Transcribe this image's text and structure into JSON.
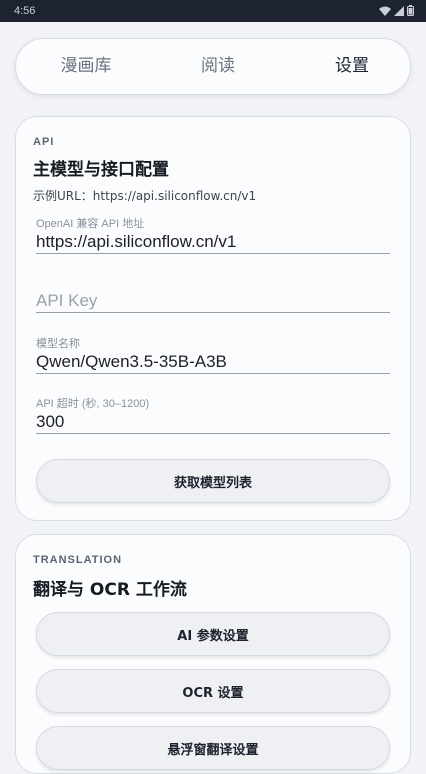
{
  "status_bar": {
    "time": "4:56"
  },
  "tabs": [
    {
      "label": "漫画库"
    },
    {
      "label": "阅读"
    },
    {
      "label": "设置"
    }
  ],
  "api_card": {
    "overline": "API",
    "title": "主模型与接口配置",
    "example_url": "示例URL：https://api.siliconflow.cn/v1",
    "fields": {
      "base_url": {
        "label": "OpenAI 兼容 API 地址",
        "value": "https://api.siliconflow.cn/v1"
      },
      "api_key": {
        "placeholder": "API Key",
        "value": ""
      },
      "model": {
        "label": "模型名称",
        "value": "Qwen/Qwen3.5-35B-A3B"
      },
      "timeout": {
        "label": "API 超时 (秒, 30–1200)",
        "value": "300"
      }
    },
    "fetch_models_button": "获取模型列表"
  },
  "translation_card": {
    "overline": "TRANSLATION",
    "title": "翻译与 OCR 工作流",
    "buttons": {
      "ai_params": "AI 参数设置",
      "ocr": "OCR 设置",
      "floating": "悬浮窗翻译设置"
    }
  }
}
